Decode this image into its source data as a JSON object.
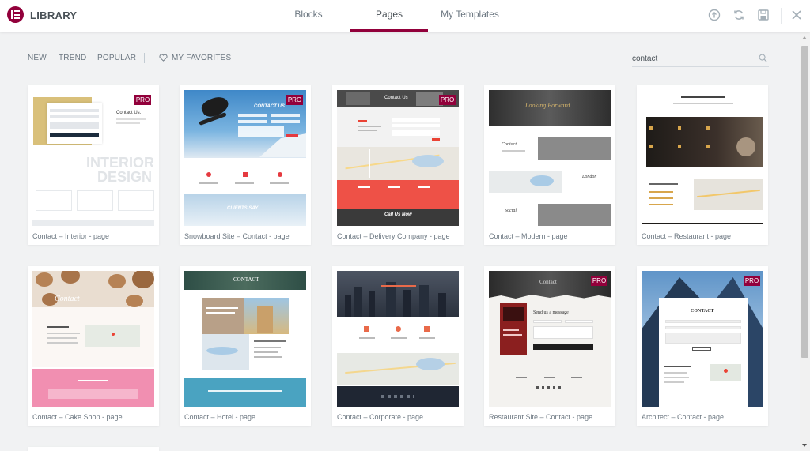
{
  "header": {
    "brand": "LIBRARY",
    "tabs": [
      {
        "label": "Blocks"
      },
      {
        "label": "Pages"
      },
      {
        "label": "My Templates"
      }
    ],
    "active_tab": "Pages",
    "accent_color": "#92003b"
  },
  "filters": {
    "items": [
      {
        "label": "NEW"
      },
      {
        "label": "TREND"
      },
      {
        "label": "POPULAR"
      }
    ],
    "favorites_label": "MY FAVORITES"
  },
  "search": {
    "value": "contact"
  },
  "pro_badge": "PRO",
  "templates": [
    {
      "title": "Contact – Interior - page",
      "pro": true
    },
    {
      "title": "Snowboard Site – Contact - page",
      "pro": true
    },
    {
      "title": "Contact – Delivery Company - page",
      "pro": true
    },
    {
      "title": "Contact – Modern - page",
      "pro": false
    },
    {
      "title": "Contact – Restaurant - page",
      "pro": false
    },
    {
      "title": "Contact – Cake Shop - page",
      "pro": false
    },
    {
      "title": "Contact – Hotel - page",
      "pro": false
    },
    {
      "title": "Contact – Corporate - page",
      "pro": false
    },
    {
      "title": "Restaurant Site – Contact - page",
      "pro": true
    },
    {
      "title": "Architect – Contact - page",
      "pro": true
    }
  ],
  "thumb_text": {
    "interior": {
      "heading": "Contact Us.",
      "big1": "INTERIOR",
      "big2": "DESIGN"
    },
    "snowboard": {
      "heading": "CONTACT US",
      "footer": "CLIENTS SAY"
    },
    "delivery": {
      "heading": "Contact Us",
      "callout": "Call Us Now"
    },
    "modern": {
      "heading": "Looking Forward",
      "contact": "Contact",
      "city": "London",
      "social": "Social"
    },
    "cake": {
      "heading": "Contact"
    },
    "hotel": {
      "heading": "CONTACT"
    },
    "restaurant2": {
      "heading": "Contact",
      "sub": "Send us a message"
    },
    "architect": {
      "heading": "CONTACT"
    }
  }
}
